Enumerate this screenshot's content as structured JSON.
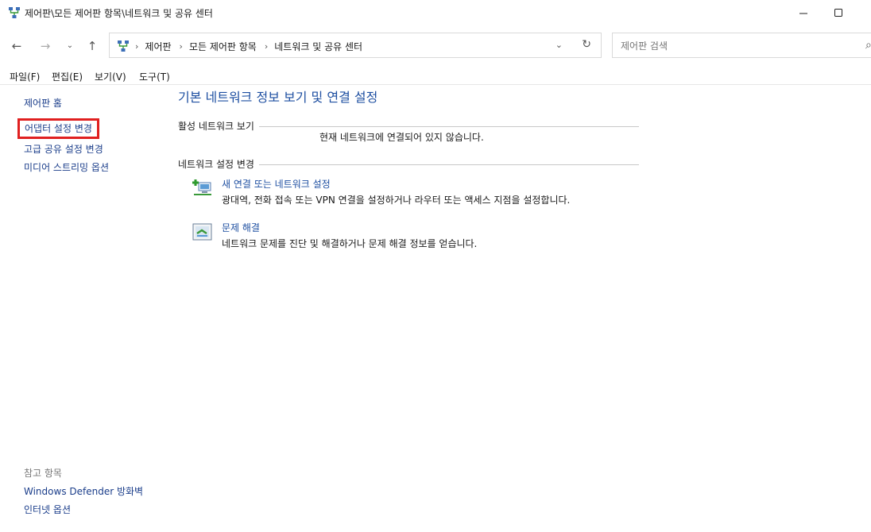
{
  "window": {
    "title": "제어판\\모든 제어판 항목\\네트워크 및 공유 센터"
  },
  "address": {
    "crumbs": [
      "제어판",
      "모든 제어판 항목",
      "네트워크 및 공유 센터"
    ],
    "search_placeholder": "제어판 검색"
  },
  "menu": [
    "파일(F)",
    "편집(E)",
    "보기(V)",
    "도구(T)"
  ],
  "sidebar": {
    "home": "제어판 홈",
    "links": [
      "어댑터 설정 변경",
      "고급 공유 설정 변경",
      "미디어 스트리밍 옵션"
    ],
    "see_also_title": "참고 항목",
    "see_also": [
      "Windows Defender 방화벽",
      "인터넷 옵션"
    ]
  },
  "main": {
    "title": "기본 네트워크 정보 보기 및 연결 설정",
    "active_section": "활성 네트워크 보기",
    "no_connection": "현재 네트워크에 연결되어 있지 않습니다.",
    "change_section": "네트워크 설정 변경",
    "tasks": [
      {
        "title": "새 연결 또는 네트워크 설정",
        "desc": "광대역, 전화 접속 또는 VPN 연결을 설정하거나 라우터 또는 액세스 지점을 설정합니다.",
        "icon": "new-connection-icon"
      },
      {
        "title": "문제 해결",
        "desc": "네트워크 문제를 진단 및 해결하거나 문제 해결 정보를 얻습니다.",
        "icon": "troubleshoot-icon"
      }
    ]
  },
  "colors": {
    "link": "#1e4fa1",
    "highlight": "#e02020"
  }
}
